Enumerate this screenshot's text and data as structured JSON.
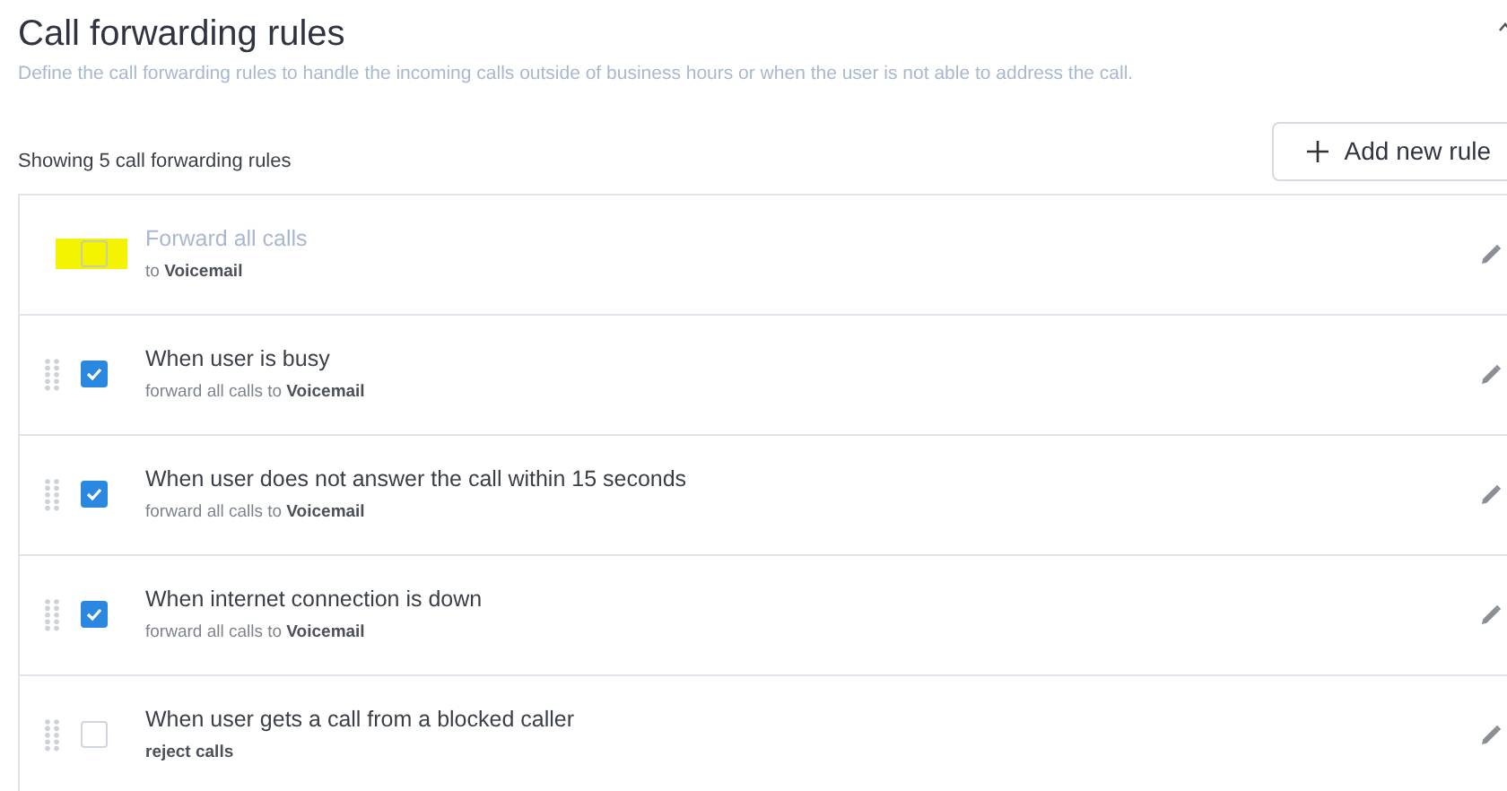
{
  "header": {
    "title": "Call forwarding rules",
    "description": "Define the call forwarding rules to handle the incoming calls outside of business hours or when the user is not able to address the call."
  },
  "summary": "Showing 5 call forwarding rules",
  "add_button": {
    "label": "Add new rule"
  },
  "rules": [
    {
      "title": "Forward all calls",
      "detail": "to **Voicemail**",
      "checked": false,
      "disabled": true,
      "draggable": false,
      "highlighted": true
    },
    {
      "title": "When user is busy",
      "detail": "forward all calls to **Voicemail**",
      "checked": true,
      "disabled": false,
      "draggable": true,
      "highlighted": false
    },
    {
      "title": "When user does not answer the call within 15 seconds",
      "detail": "forward all calls to **Voicemail**",
      "checked": true,
      "disabled": false,
      "draggable": true,
      "highlighted": false
    },
    {
      "title": "When internet connection is down",
      "detail": "forward all calls to **Voicemail**",
      "checked": true,
      "disabled": false,
      "draggable": true,
      "highlighted": false
    },
    {
      "title": "When user gets a call from a blocked caller",
      "detail": "**reject calls**",
      "checked": false,
      "disabled": false,
      "draggable": true,
      "highlighted": false
    }
  ]
}
